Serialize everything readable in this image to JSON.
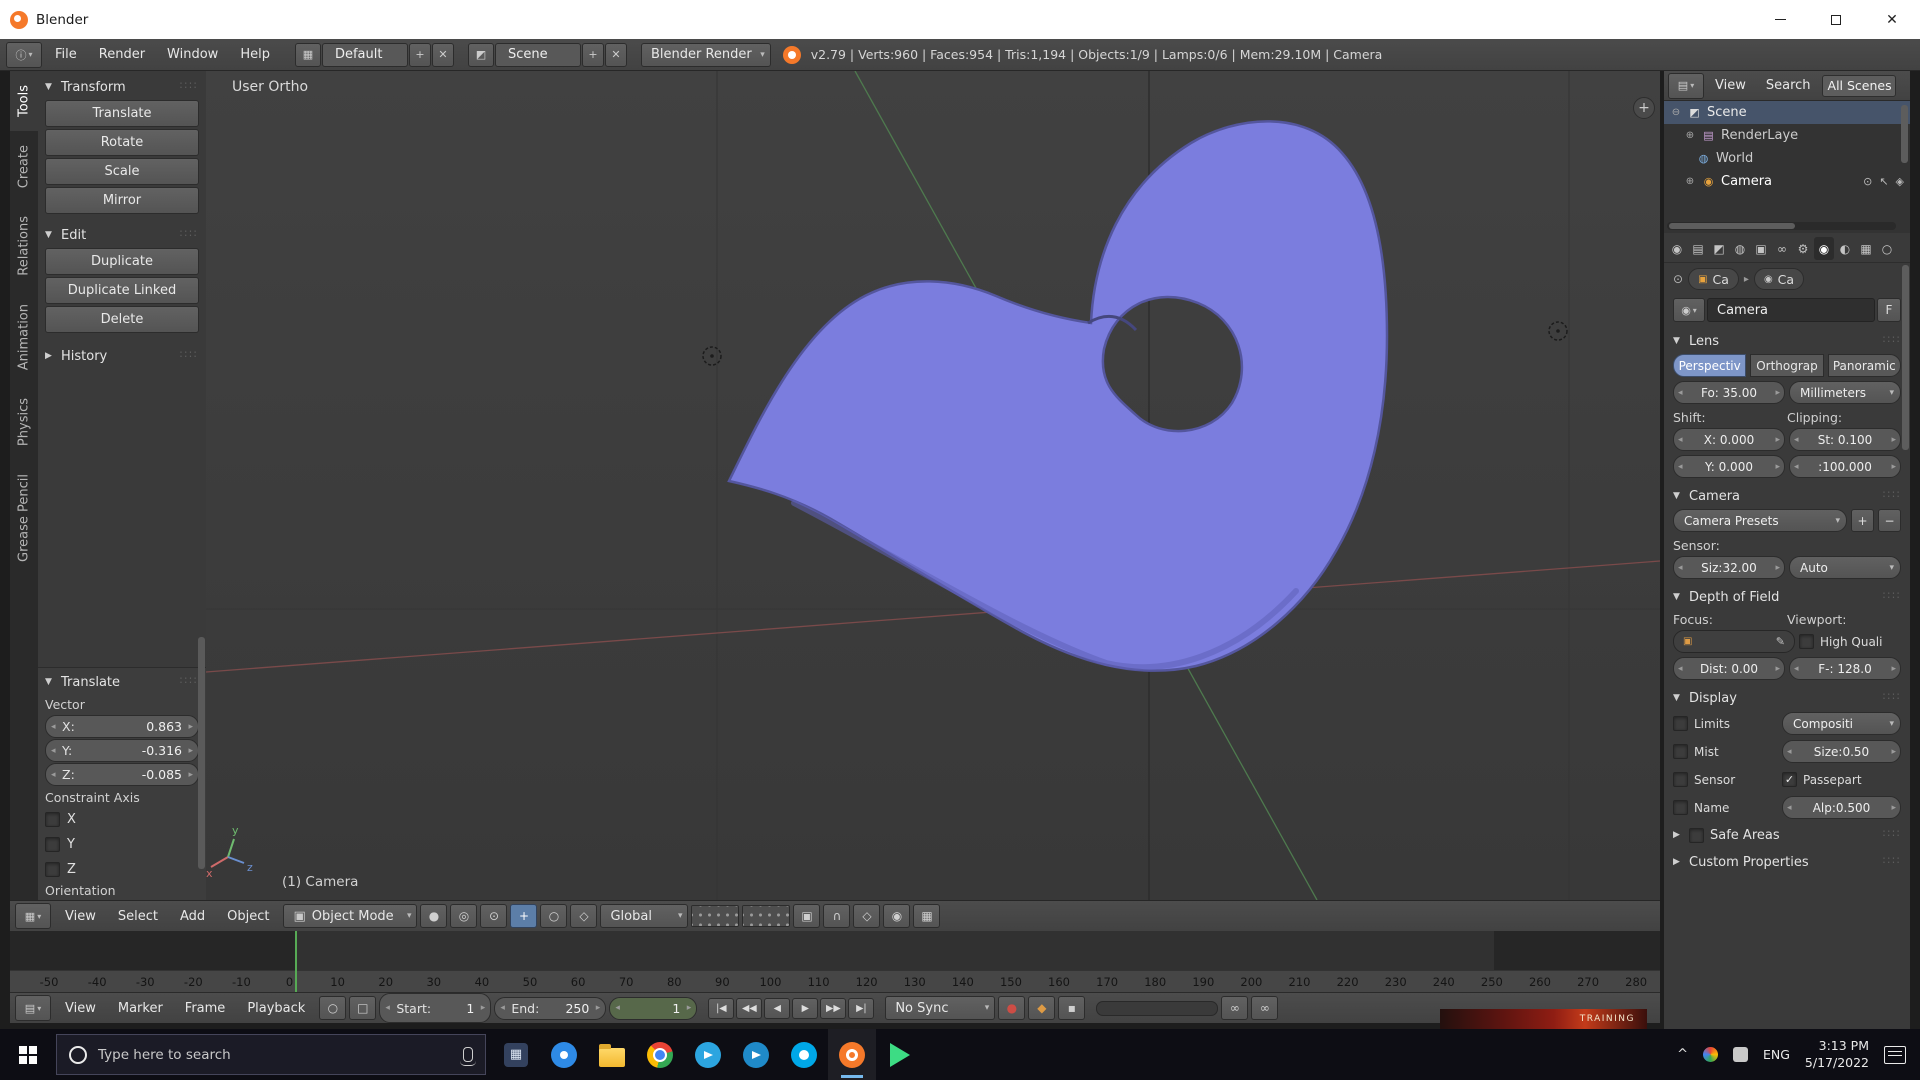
{
  "window": {
    "title": "Blender"
  },
  "infobar": {
    "menus": [
      "File",
      "Render",
      "Window",
      "Help"
    ],
    "layout": "Default",
    "scene": "Scene",
    "engine": "Blender Render",
    "stats": "v2.79 | Verts:960 | Faces:954 | Tris:1,194 | Objects:1/9 | Lamps:0/6 | Mem:29.10M | Camera"
  },
  "toolshelf": {
    "tabs": [
      "Tools",
      "Create",
      "Relations",
      "Animation",
      "Physics",
      "Grease Pencil"
    ],
    "active_tab": "Tools",
    "transform_panel": {
      "title": "Transform",
      "buttons": [
        "Translate",
        "Rotate",
        "Scale",
        "Mirror"
      ]
    },
    "edit_panel": {
      "title": "Edit",
      "buttons": [
        "Duplicate",
        "Duplicate Linked",
        "Delete"
      ]
    },
    "history_panel": {
      "title": "History"
    },
    "operator_panel": {
      "title": "Translate",
      "vector_label": "Vector",
      "x_label": "X:",
      "x_value": "0.863",
      "y_label": "Y:",
      "y_value": "-0.316",
      "z_label": "Z:",
      "z_value": "-0.085",
      "constraint_label": "Constraint Axis",
      "axis_x": "X",
      "axis_y": "Y",
      "axis_z": "Z",
      "orientation_label": "Orientation"
    }
  },
  "viewport": {
    "view_label": "User Ortho",
    "camera_label": "(1) Camera",
    "object_color": "#7b7dde",
    "gizmo": {
      "x": "x",
      "y": "y",
      "z": "z"
    }
  },
  "viewport_header": {
    "menus": [
      "View",
      "Select",
      "Add",
      "Object"
    ],
    "mode": "Object Mode",
    "orientation": "Global"
  },
  "timeline": {
    "menus": [
      "View",
      "Marker",
      "Frame",
      "Playback"
    ],
    "start_label": "Start:",
    "start_value": "1",
    "end_label": "End:",
    "end_value": "250",
    "frame_value": "1",
    "sync": "No Sync",
    "ticks": [
      "-50",
      "-40",
      "-30",
      "-20",
      "-10",
      "0",
      "10",
      "20",
      "30",
      "40",
      "50",
      "60",
      "70",
      "80",
      "90",
      "100",
      "110",
      "120",
      "130",
      "140",
      "150",
      "160",
      "170",
      "180",
      "190",
      "200",
      "210",
      "220",
      "230",
      "240",
      "250",
      "260",
      "270",
      "280"
    ]
  },
  "outliner": {
    "view_menu": "View",
    "search_menu": "Search",
    "scope": "All Scenes",
    "scene": "Scene",
    "render_layers": "RenderLaye",
    "world": "World",
    "camera": "Camera"
  },
  "properties": {
    "breadcrumb_object": "Ca",
    "breadcrumb_data": "Ca",
    "id_name": "Camera",
    "fake_user": "F",
    "lens": {
      "title": "Lens",
      "perspective": "Perspectiv",
      "orthographic": "Orthograp",
      "panoramic": "Panoramic",
      "focal": "Fo: 35.00",
      "units": "Millimeters",
      "shift_label": "Shift:",
      "clipping_label": "Clipping:",
      "shift_x": "X:  0.000",
      "clip_start": "St: 0.100",
      "shift_y": "Y:  0.000",
      "clip_end": ":100.000"
    },
    "camera": {
      "title": "Camera",
      "presets": "Camera Presets",
      "sensor_label": "Sensor:",
      "size": "Siz:32.00",
      "fit": "Auto"
    },
    "dof": {
      "title": "Depth of Field",
      "focus_label": "Focus:",
      "viewport_label": "Viewport:",
      "high_quality": "High Quali",
      "distance": "Dist: 0.00",
      "fstop": "F-: 128.0"
    },
    "display": {
      "title": "Display",
      "limits": "Limits",
      "mist": "Mist",
      "sensor": "Sensor",
      "name": "Name",
      "composition": "Compositi",
      "size": "Size:0.50",
      "passepartout": "Passepart",
      "alpha": "Alp:0.500"
    },
    "safe_areas": {
      "title": "Safe Areas"
    },
    "custom_props": {
      "title": "Custom Properties"
    }
  },
  "background_window": {
    "text": "TRAINING"
  },
  "taskbar": {
    "search_placeholder": "Type here to search",
    "language": "ENG",
    "time": "3:13 PM",
    "date": "5/17/2022"
  },
  "icons": {
    "properties_tabs": [
      "◉",
      "▤",
      "◩",
      "◍",
      "▣",
      "∞",
      "⚙",
      "◉",
      "◐",
      "▦",
      "○"
    ],
    "transport": [
      "|◀",
      "◀◀",
      "◀",
      "▶",
      "▶▶",
      "▶|"
    ]
  }
}
